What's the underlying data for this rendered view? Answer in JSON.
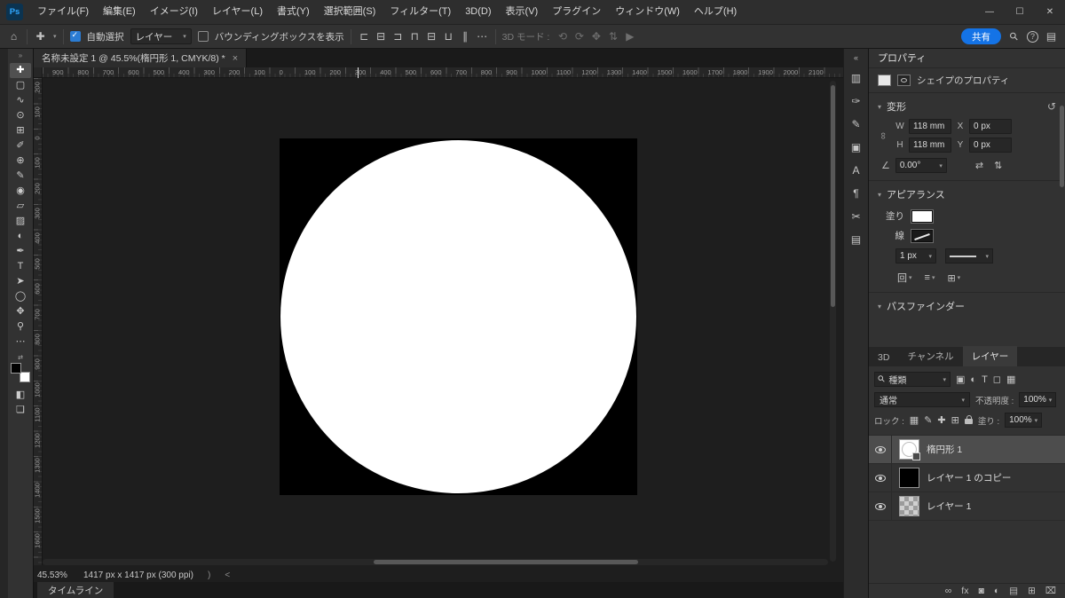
{
  "titlebar": {
    "app_icon": "Ps",
    "menu_items": [
      "ファイル(F)",
      "編集(E)",
      "イメージ(I)",
      "レイヤー(L)",
      "書式(Y)",
      "選択範囲(S)",
      "フィルター(T)",
      "3D(D)",
      "表示(V)",
      "プラグイン",
      "ウィンドウ(W)",
      "ヘルプ(H)"
    ],
    "window_controls": [
      {
        "name": "minimize",
        "glyph": "—"
      },
      {
        "name": "maximize",
        "glyph": "☐"
      },
      {
        "name": "close",
        "glyph": "✕"
      }
    ]
  },
  "glyphs": {
    "home": "⌂",
    "move_tool": "✚",
    "chevron_down": "▾",
    "ellipsis": "⋯",
    "search": "⚲",
    "help": "?",
    "workspace": "▤",
    "collapse_left": "«",
    "collapse_right": "»",
    "swap": "⇄",
    "flip_h": "⇄",
    "flip_v": "⇅",
    "chain": "∞",
    "angle": "∠",
    "reset": "↺",
    "section_chevron": "▾",
    "mask_mode": "◧",
    "screen_mode": "❏",
    "stroke_align": "回",
    "stroke_caps": "≡",
    "stroke_corners": "⊞"
  },
  "options_bar": {
    "auto_select_label": "自動選択",
    "auto_select_checked": true,
    "target_value": "レイヤー",
    "bbox_label": "バウンディングボックスを表示",
    "bbox_checked": false,
    "mode_3d_label": "3D モード :",
    "share_label": "共有",
    "align_icons": [
      {
        "name": "align-left",
        "glyph": "⊏"
      },
      {
        "name": "align-center-horizontal",
        "glyph": "⊟"
      },
      {
        "name": "align-right",
        "glyph": "⊐"
      },
      {
        "name": "align-top",
        "glyph": "⊓"
      },
      {
        "name": "align-middle",
        "glyph": "⊟"
      },
      {
        "name": "align-bottom",
        "glyph": "⊔"
      },
      {
        "name": "distribute",
        "glyph": "∥"
      },
      {
        "name": "more-align-options",
        "glyph": "⋯"
      }
    ],
    "mode_3d_icons": [
      {
        "name": "3d-rotate",
        "glyph": "⟲"
      },
      {
        "name": "3d-roll",
        "glyph": "⟳"
      },
      {
        "name": "3d-pan",
        "glyph": "✥"
      },
      {
        "name": "3d-slide",
        "glyph": "⇅"
      },
      {
        "name": "3d-camera",
        "glyph": "▶"
      }
    ]
  },
  "document_tab": {
    "title": "名称未設定 1 @ 45.5%(楕円形 1, CMYK/8) *",
    "close_glyph": "×"
  },
  "toolbar": {
    "tools": [
      {
        "name": "move-tool",
        "glyph": "✚",
        "selected": true
      },
      {
        "name": "marquee-tool",
        "glyph": "▢"
      },
      {
        "name": "lasso-tool",
        "glyph": "∿"
      },
      {
        "name": "object-selection-tool",
        "glyph": "⊙"
      },
      {
        "name": "crop-tool",
        "glyph": "⊞"
      },
      {
        "name": "eyedropper-tool",
        "glyph": "✐"
      },
      {
        "name": "healing-brush-tool",
        "glyph": "⊕"
      },
      {
        "name": "brush-tool",
        "glyph": "✎"
      },
      {
        "name": "clone-stamp-tool",
        "glyph": "◉"
      },
      {
        "name": "eraser-tool",
        "glyph": "▱"
      },
      {
        "name": "gradient-tool",
        "glyph": "▨"
      },
      {
        "name": "dodge-tool",
        "glyph": "◐"
      },
      {
        "name": "pen-tool",
        "glyph": "✒"
      },
      {
        "name": "type-tool",
        "glyph": "T"
      },
      {
        "name": "path-selection-tool",
        "glyph": "➤"
      },
      {
        "name": "shape-tool",
        "glyph": "◯"
      },
      {
        "name": "hand-tool",
        "glyph": "✥"
      },
      {
        "name": "zoom-tool",
        "glyph": "⚲"
      },
      {
        "name": "more-tools",
        "glyph": "⋯"
      }
    ]
  },
  "dock": {
    "icons": [
      {
        "name": "adjustments-panel",
        "glyph": "▥"
      },
      {
        "name": "brush-settings-panel",
        "glyph": "✑"
      },
      {
        "name": "brushes-panel",
        "glyph": "✎"
      },
      {
        "name": "clone-source-panel",
        "glyph": "▣"
      },
      {
        "name": "character-panel",
        "glyph": "A"
      },
      {
        "name": "paragraph-panel",
        "glyph": "¶"
      },
      {
        "name": "glyphs-panel",
        "glyph": "✂"
      },
      {
        "name": "libraries-panel",
        "glyph": "▤"
      }
    ]
  },
  "rulers": {
    "top": [
      "900",
      "800",
      "700",
      "600",
      "500",
      "400",
      "300",
      "200",
      "100",
      "0",
      "100",
      "200",
      "300",
      "400",
      "500",
      "600",
      "700",
      "800",
      "900",
      "1000",
      "1100",
      "1200",
      "1300",
      "1400",
      "1500",
      "1600",
      "1700",
      "1800",
      "1900",
      "2000",
      "2100"
    ],
    "left": [
      "200",
      "100",
      "0",
      "100",
      "200",
      "300",
      "400",
      "500",
      "600",
      "700",
      "800",
      "900",
      "1000",
      "1100",
      "1200",
      "1300",
      "1400",
      "1500",
      "1600"
    ]
  },
  "status_bar": {
    "zoom": "45.53%",
    "info": "1417 px x 1417 px (300 ppi)",
    "mark1": ")",
    "mark2": "<"
  },
  "timeline": {
    "label": "タイムライン"
  },
  "properties": {
    "title": "プロパティ",
    "subtitle": "シェイプのプロパティ",
    "transform": {
      "title": "変形",
      "w_label": "W",
      "w_value": "118 mm",
      "x_label": "X",
      "x_value": "0 px",
      "h_label": "H",
      "h_value": "118 mm",
      "y_label": "Y",
      "y_value": "0 px",
      "angle_value": "0.00°"
    },
    "appearance": {
      "title": "アピアランス",
      "fill_label": "塗り",
      "stroke_label": "線",
      "stroke_width_value": "1 px"
    },
    "pathfinder_title": "パスファインダー"
  },
  "panel_tabs": [
    {
      "name": "tab-3d",
      "label": "3D",
      "active": false
    },
    {
      "name": "tab-channels",
      "label": "チャンネル",
      "active": false
    },
    {
      "name": "tab-layers",
      "label": "レイヤー",
      "active": true
    }
  ],
  "layers_panel": {
    "search_value": "種類",
    "blend_mode": "通常",
    "opacity_label": "不透明度 :",
    "opacity_value": "100%",
    "lock_label": "ロック :",
    "fill_label": "塗り :",
    "fill_value": "100%",
    "filter_icons": [
      {
        "name": "filter-pixel-layers",
        "glyph": "▣"
      },
      {
        "name": "filter-adjustment-layers",
        "glyph": "◐"
      },
      {
        "name": "filter-type-layers",
        "glyph": "T"
      },
      {
        "name": "filter-shape-layers",
        "glyph": "◻"
      },
      {
        "name": "filter-smart-objects",
        "glyph": "▦"
      }
    ],
    "lock_icons": [
      {
        "name": "lock-transparent-pixels",
        "glyph": "▦"
      },
      {
        "name": "lock-image-pixels",
        "glyph": "✎"
      },
      {
        "name": "lock-position",
        "glyph": "✚"
      },
      {
        "name": "lock-artboard",
        "glyph": "⊞"
      },
      {
        "name": "lock-all",
        "glyph": "padlock"
      }
    ],
    "layers": [
      {
        "name": "楕円形 1",
        "thumb": "ellipse",
        "selected": true
      },
      {
        "name": "レイヤー 1 のコピー",
        "thumb": "black",
        "selected": false
      },
      {
        "name": "レイヤー 1",
        "thumb": "checker",
        "selected": false
      }
    ],
    "ops_icons": [
      {
        "name": "link-layers",
        "glyph": "∞"
      },
      {
        "name": "layer-effects",
        "glyph": "fx"
      },
      {
        "name": "add-layer-mask",
        "glyph": "◙"
      },
      {
        "name": "new-adjustment-layer",
        "glyph": "◐"
      },
      {
        "name": "new-group",
        "glyph": "▤"
      },
      {
        "name": "new-layer",
        "glyph": "⊞"
      },
      {
        "name": "delete-layer",
        "glyph": "⌧"
      }
    ]
  },
  "colors": {
    "accent_blue": "#1473e6",
    "canvas_background": "#1e1e1e",
    "artboard_black": "#000000",
    "shape_white": "#ffffff"
  }
}
